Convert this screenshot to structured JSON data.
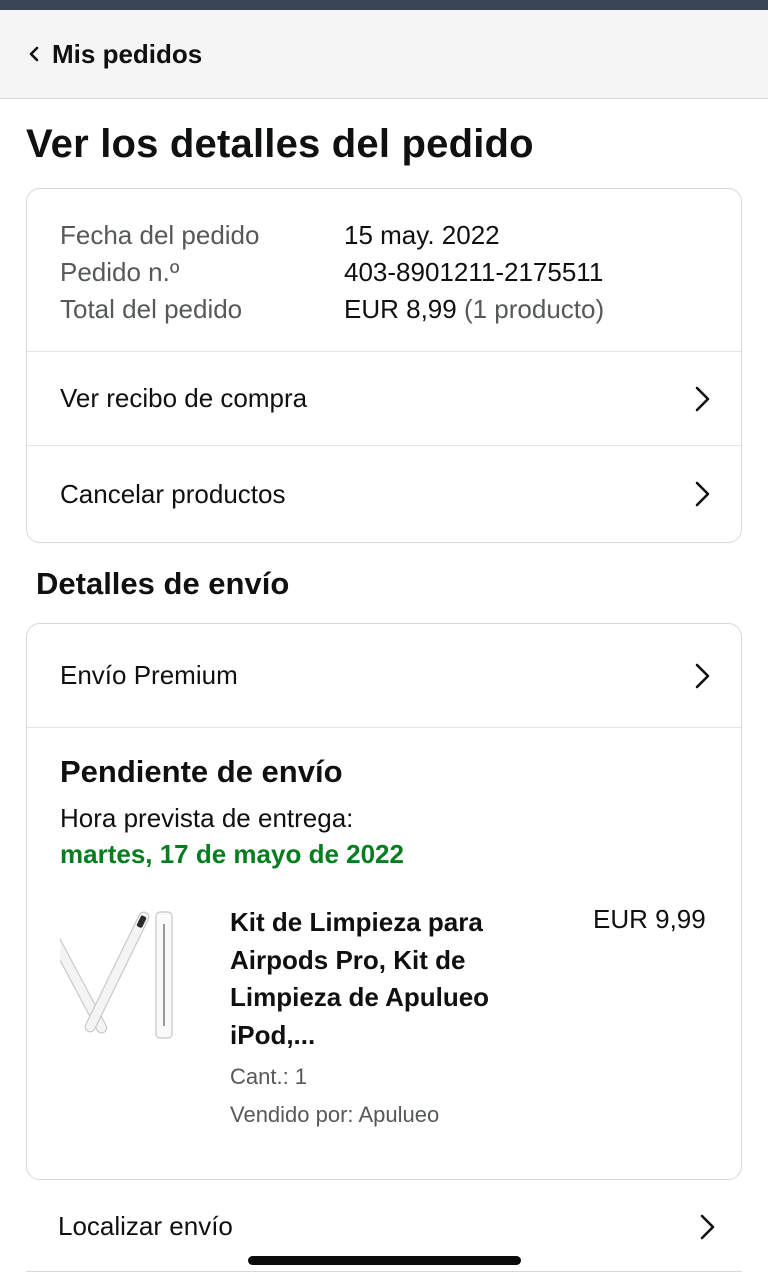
{
  "header": {
    "back_label": "Mis pedidos"
  },
  "page": {
    "title": "Ver los detalles del pedido"
  },
  "order_summary": {
    "rows": [
      {
        "key": "Fecha del pedido",
        "value": "15 may. 2022"
      },
      {
        "key": "Pedido n.º",
        "value": "403-8901211-2175511"
      },
      {
        "key": "Total del pedido",
        "value": "EUR 8,99",
        "extra": "(1 producto)"
      }
    ]
  },
  "order_actions": {
    "receipt_label": "Ver recibo de compra",
    "cancel_label": "Cancelar productos"
  },
  "shipping": {
    "section_title": "Detalles de envío",
    "method_label": "Envío Premium",
    "status": "Pendiente de envío",
    "eta_label": "Hora prevista de entrega:",
    "eta_date": "martes, 17 de mayo de 2022",
    "eta_color": "#067d1f"
  },
  "product": {
    "title": "Kit de Limpieza para Airpods Pro, Kit de Limpieza de Apulueo iPod,...",
    "quantity": "Cant.: 1",
    "seller": "Vendido por: Apulueo",
    "price": "EUR 9,99",
    "image": "cleaning-pens-image"
  },
  "tracking": {
    "label": "Localizar envío"
  },
  "icons": {
    "back": "chevron-left-icon",
    "row": "chevron-right-icon"
  }
}
